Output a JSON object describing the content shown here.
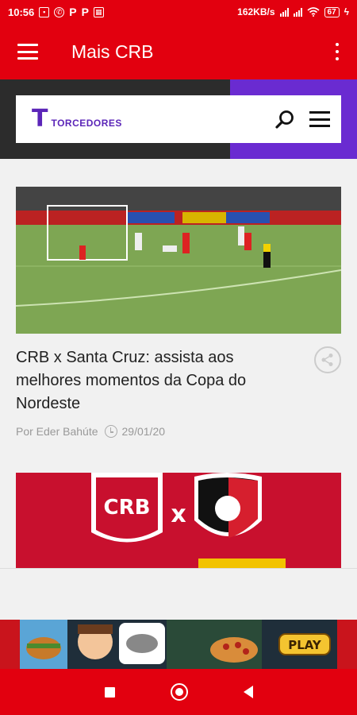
{
  "status_bar": {
    "time": "10:56",
    "net_speed": "162KB/s",
    "battery": "67",
    "p1": "P",
    "p2": "P"
  },
  "app_bar": {
    "title": "Mais CRB"
  },
  "banner": {
    "brand_letter": "T",
    "brand_name": "TORCEDORES"
  },
  "article": {
    "title": "CRB x Santa Cruz: assista aos melhores momentos da Copa do Nordeste",
    "author": "Por Eder Bahúte",
    "date": "29/01/20"
  },
  "second_article": {
    "home": "CRB",
    "vs": "x"
  },
  "ad": {
    "play_label": "PLAY"
  },
  "colors": {
    "primary": "#e2000f",
    "banner_dark": "#2c2c2c",
    "banner_purple": "#6a2bd1",
    "brand_purple": "#5b25b8"
  },
  "icons": {
    "menu": "hamburger-menu-icon",
    "overflow": "more-vert-icon",
    "search": "search-icon",
    "share": "share-icon",
    "clock": "clock-icon"
  }
}
